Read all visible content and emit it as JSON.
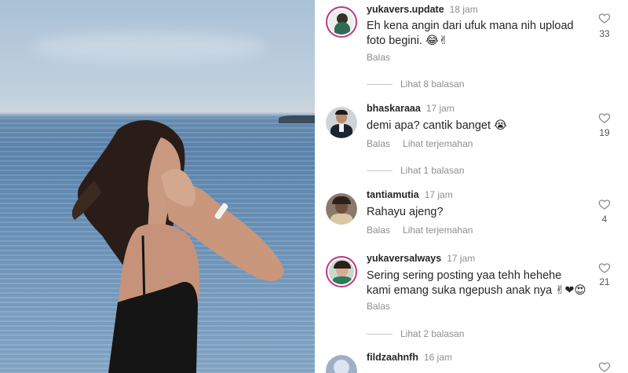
{
  "photo": {
    "alt_icon": "beach-photo"
  },
  "comments": [
    {
      "username": "yukavers.update",
      "time": "18 jam",
      "text": "Eh kena angin dari ufuk mana nih upload foto begini. 😂✌",
      "reply": "Balas",
      "translate": "",
      "likes": "33",
      "replies": "Lihat 8 balasan"
    },
    {
      "username": "bhaskaraaa",
      "time": "17 jam",
      "text": "demi apa? cantik banget 😭",
      "reply": "Balas",
      "translate": "Lihat terjemahan",
      "likes": "19",
      "replies": "Lihat 1 balasan"
    },
    {
      "username": "tantiamutia",
      "time": "17 jam",
      "text": "Rahayu ajeng?",
      "reply": "Balas",
      "translate": "Lihat terjemahan",
      "likes": "4",
      "replies": ""
    },
    {
      "username": "yukaversalways",
      "time": "17 jam",
      "text": "Sering sering posting yaa tehh hehehe kami emang suka ngepush anak nya ✌❤😍",
      "reply": "Balas",
      "translate": "",
      "likes": "21",
      "replies": "Lihat 2 balasan"
    },
    {
      "username": "fildzaahnfh",
      "time": "16 jam",
      "text": "",
      "reply": "",
      "translate": "",
      "likes": "",
      "replies": ""
    }
  ],
  "colors": {
    "story_ring": "#c13584",
    "muted": "#8e8e8e",
    "text": "#262626"
  }
}
